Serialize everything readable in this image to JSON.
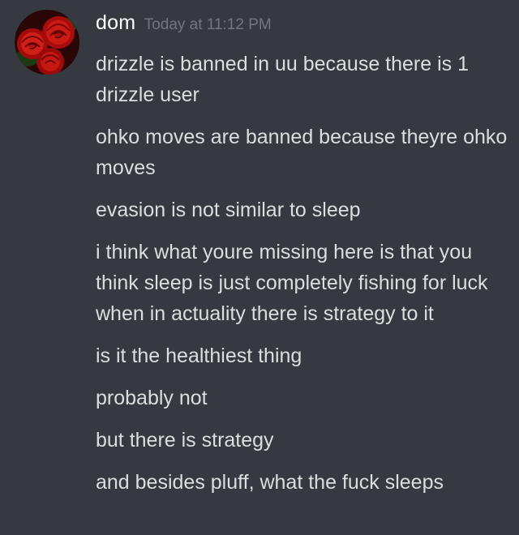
{
  "author": {
    "name": "dom",
    "timestamp": "Today at 11:12 PM",
    "avatar_icon": "roses-avatar-icon"
  },
  "messages": [
    "drizzle is banned in uu because there is 1 drizzle user",
    "ohko moves are banned because theyre ohko moves",
    "evasion is not similar to sleep",
    "i think what youre missing here is that you think sleep is just completely fishing for luck when in actuality there is strategy to it",
    "is it the healthiest thing",
    "probably not",
    "but there is strategy",
    "and besides pluff, what the fuck sleeps"
  ],
  "colors": {
    "background": "#36393f",
    "username": "#ffffff",
    "timestamp": "#72767d",
    "message_text": "#dcddde"
  }
}
